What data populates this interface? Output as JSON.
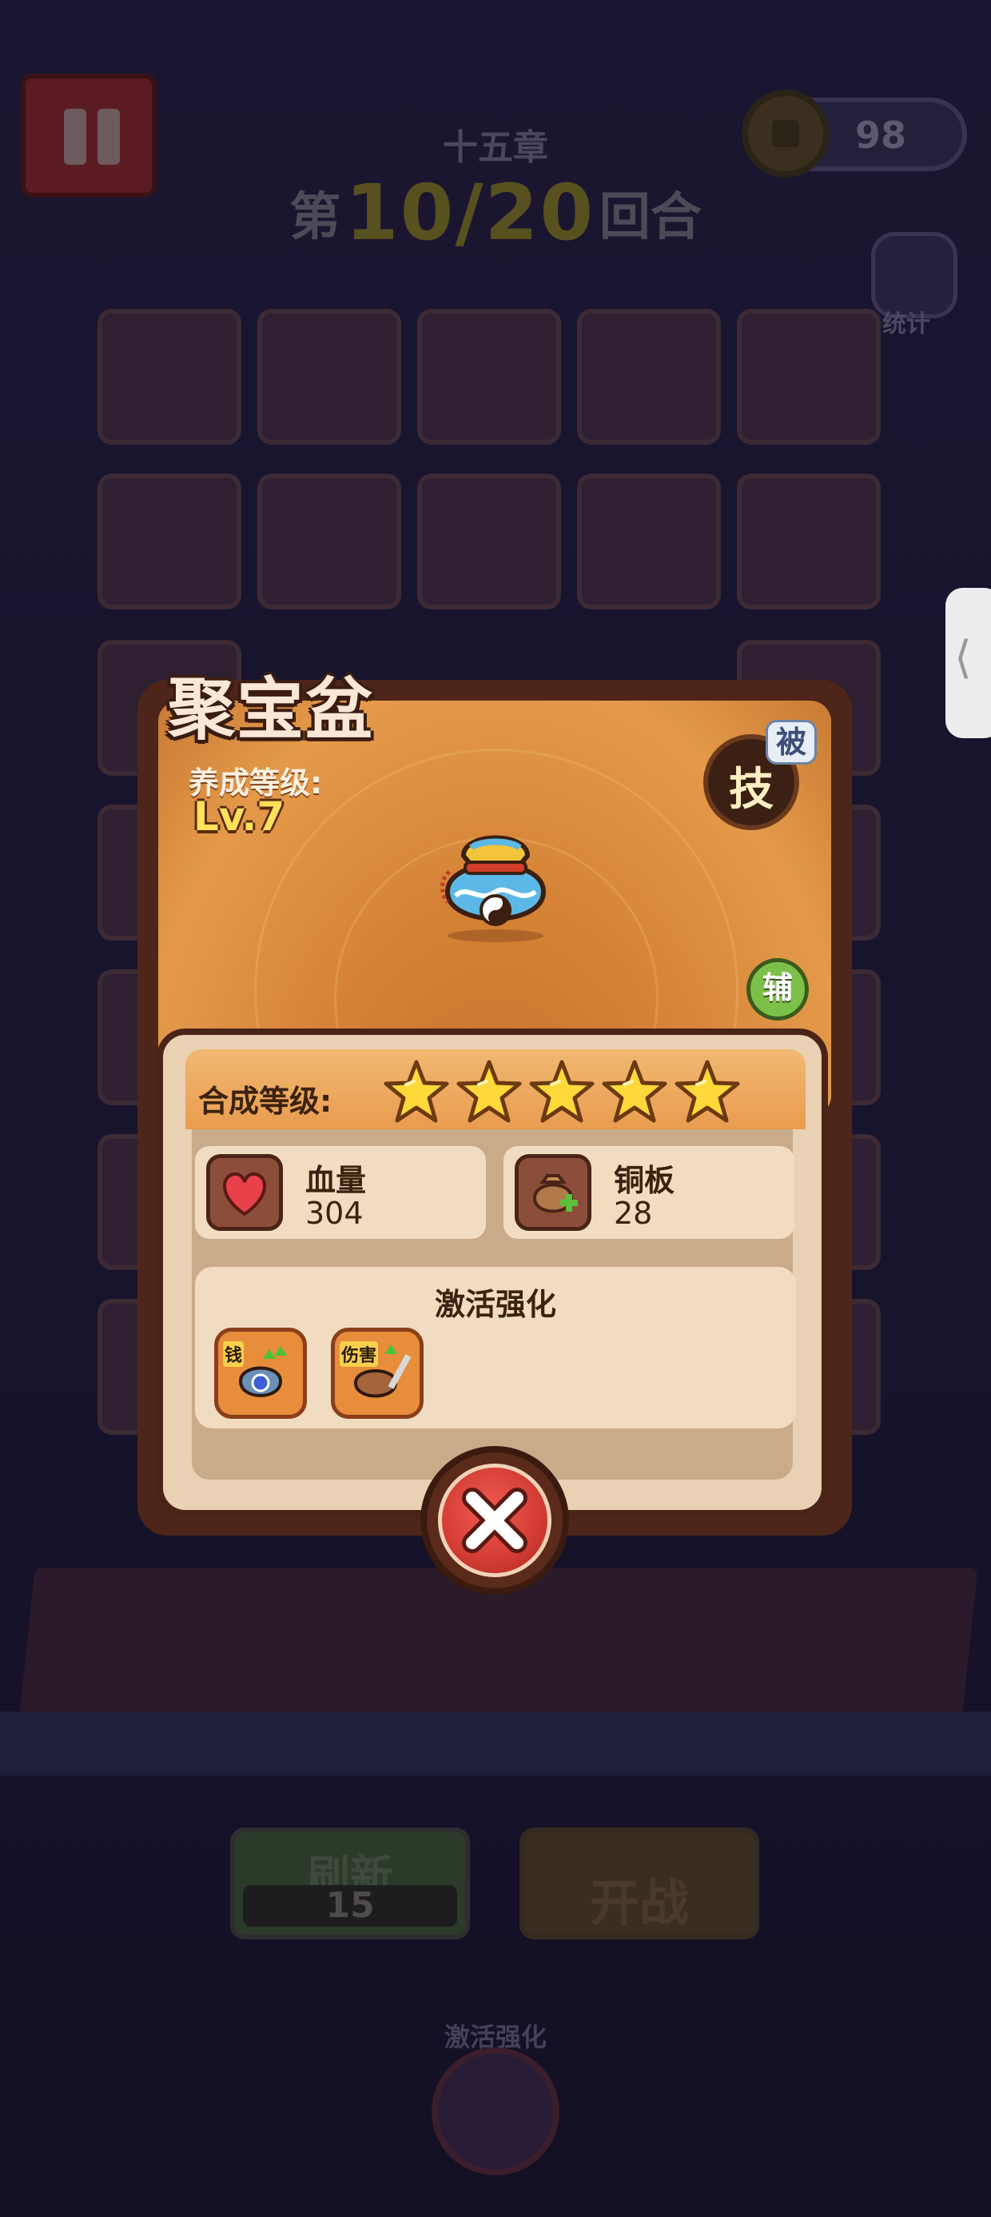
{
  "hud": {
    "chapter": "十五章",
    "round_prefix": "第",
    "round_value": "10/20",
    "round_suffix": "回合",
    "coins": "98",
    "stats_label": "统计"
  },
  "actions": {
    "refresh_label": "刷新",
    "refresh_cost": "15",
    "battle_label": "开战",
    "bottom_label": "激活强化"
  },
  "item": {
    "name": "聚宝盆",
    "level_caption": "养成等级:",
    "level_value": "Lv.7",
    "skill_char": "技",
    "passive_tag": "被",
    "support_tag": "辅",
    "icon": "treasure-bag-icon"
  },
  "merge": {
    "label": "合成等级:",
    "stars": 5
  },
  "stats": [
    {
      "name": "血量",
      "value": "304",
      "icon": "heart-icon"
    },
    {
      "name": "铜板",
      "value": "28",
      "icon": "coin-bag-plus-icon"
    }
  ],
  "enhance": {
    "title": "激活强化",
    "items": [
      {
        "tag": "钱",
        "icon": "money-bag-up-icon"
      },
      {
        "tag": "伤害",
        "icon": "damage-up-icon"
      }
    ]
  },
  "colors": {
    "dialog_border": "#4e2619",
    "panel_orange": "#d58236",
    "star_yellow": "#ffd83a",
    "close_red": "#d23c34"
  }
}
